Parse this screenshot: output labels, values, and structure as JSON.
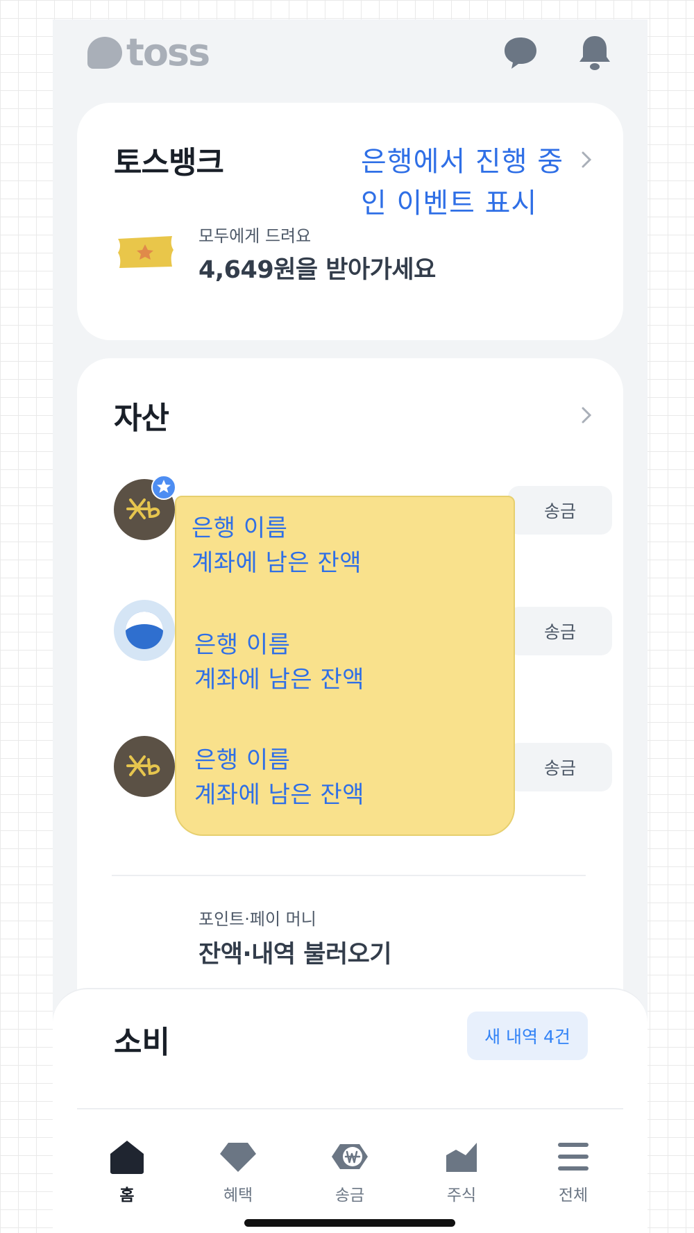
{
  "app": {
    "logo_text": "toss"
  },
  "header": {
    "chat_icon": "chat-bubble-icon",
    "bell_icon": "bell-icon"
  },
  "bank_card": {
    "title": "토스뱅크",
    "note_line1": "은행에서 진행 중",
    "note_line2": "인 이벤트 표시",
    "promo_sub": "모두에게 드려요",
    "promo_main": "4,649원을 받아가세요"
  },
  "assets": {
    "title": "자산",
    "accounts": [
      {
        "bank_icon": "kb-bank-icon",
        "note_line1": "은행 이름",
        "note_line2": "계좌에 남은 잔액",
        "button": "송금"
      },
      {
        "bank_icon": "woori-bank-icon",
        "note_line1": "은행 이름",
        "note_line2": "계좌에 남은 잔액",
        "button": "송금"
      },
      {
        "bank_icon": "kb-bank-icon",
        "note_line1": "은행 이름",
        "note_line2": "계좌에 남은 잔액",
        "button": "송금"
      }
    ],
    "points_sub": "포인트·페이 머니",
    "points_main": "잔액·내역 불러오기"
  },
  "spending": {
    "title": "소비",
    "badge": "새 내역 4건"
  },
  "nav": {
    "items": [
      {
        "label": "홈",
        "icon": "home-icon",
        "active": true
      },
      {
        "label": "혜택",
        "icon": "gem-icon",
        "active": false
      },
      {
        "label": "송금",
        "icon": "won-transfer-icon",
        "active": false
      },
      {
        "label": "주식",
        "icon": "stock-chart-icon",
        "active": false
      },
      {
        "label": "전체",
        "icon": "menu-icon",
        "active": false
      }
    ]
  },
  "colors": {
    "accent_blue": "#3182f6",
    "annotation_blue": "#2f6fe6",
    "note_yellow": "#f9e18c",
    "background": "#f2f4f6"
  }
}
